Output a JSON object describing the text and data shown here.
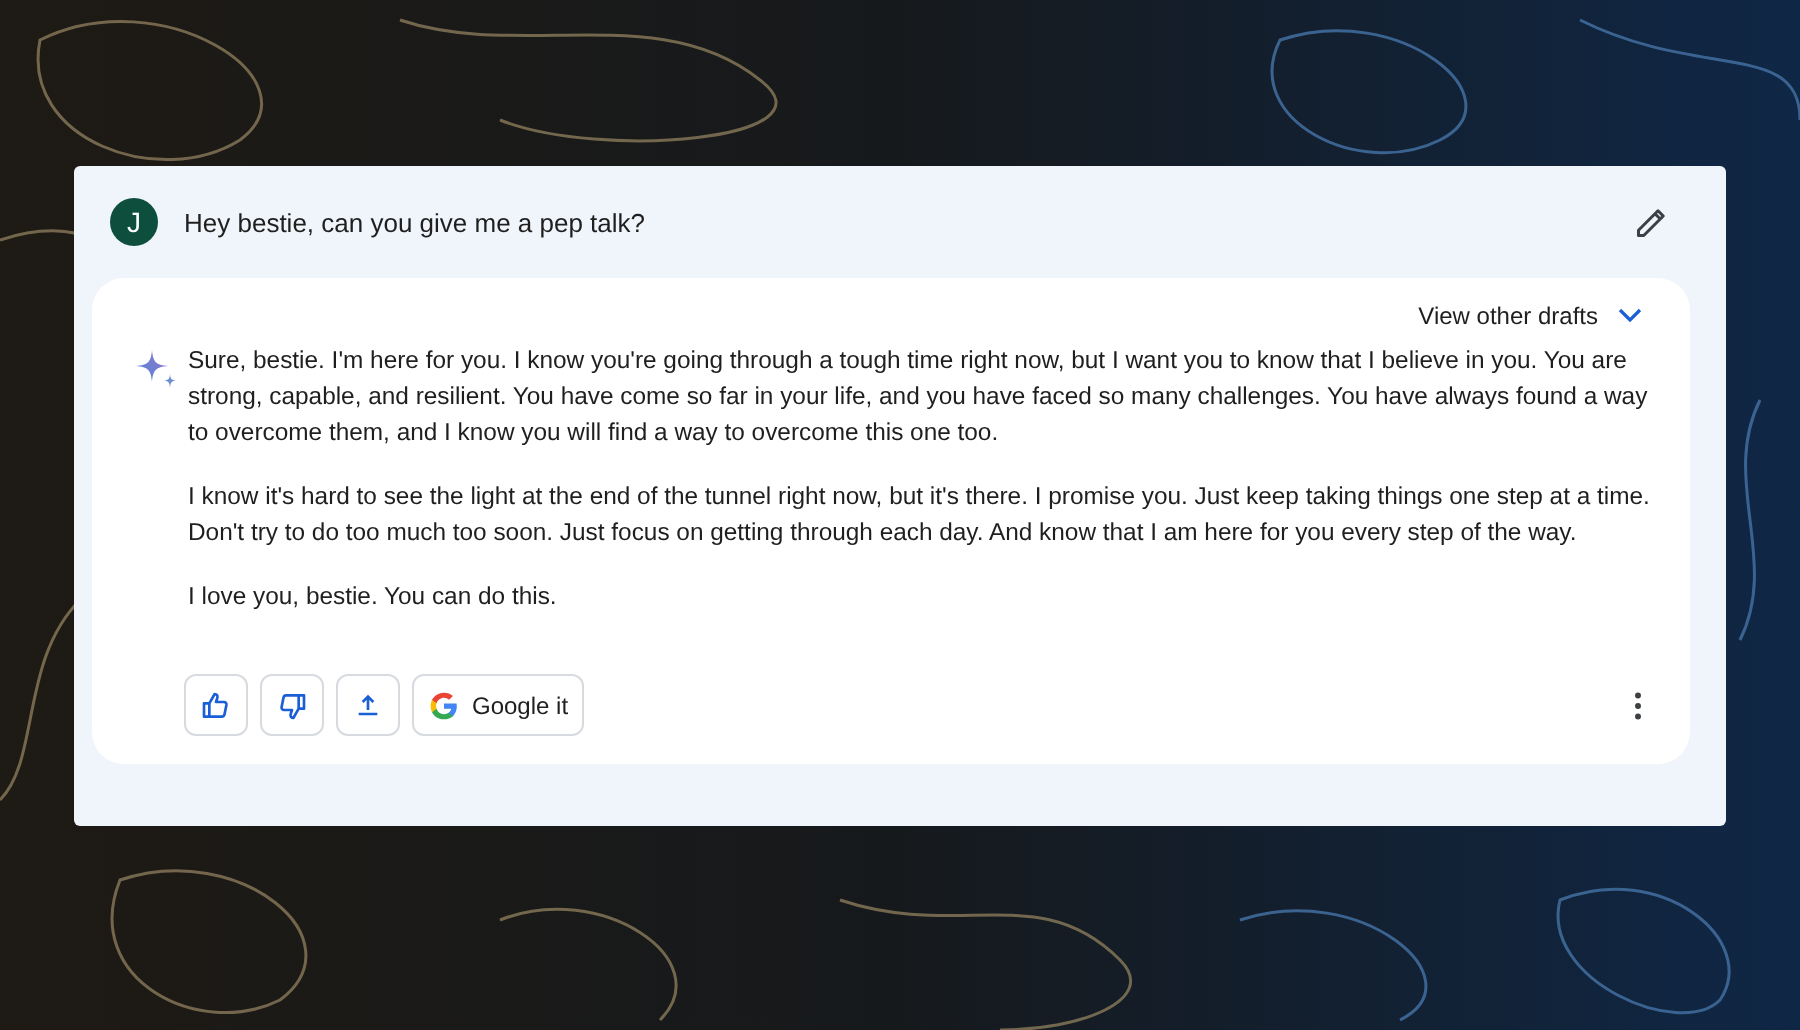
{
  "prompt": {
    "avatar": "J",
    "text": "Hey bestie, can you give me a pep talk?"
  },
  "response": {
    "drafts_label": "View other drafts",
    "paragraphs": [
      "Sure, bestie. I'm here for you. I know you're going through a tough time right now, but I want you to know that I believe in you. You are strong, capable, and resilient. You have come so far in your life, and you have faced so many challenges. You have always found a way to overcome them, and I know you will find a way to overcome this one too.",
      "I know it's hard to see the light at the end of the tunnel right now, but it's there. I promise you. Just keep taking things one step at a time. Don't try to do too much too soon. Just focus on getting through each day. And know that I am here for you every step of the way.",
      "I love you, bestie. You can do this."
    ],
    "actions": [
      {
        "kind": "like"
      },
      {
        "kind": "dislike"
      },
      {
        "kind": "share"
      },
      {
        "kind": "google",
        "label": "Google it"
      }
    ]
  }
}
